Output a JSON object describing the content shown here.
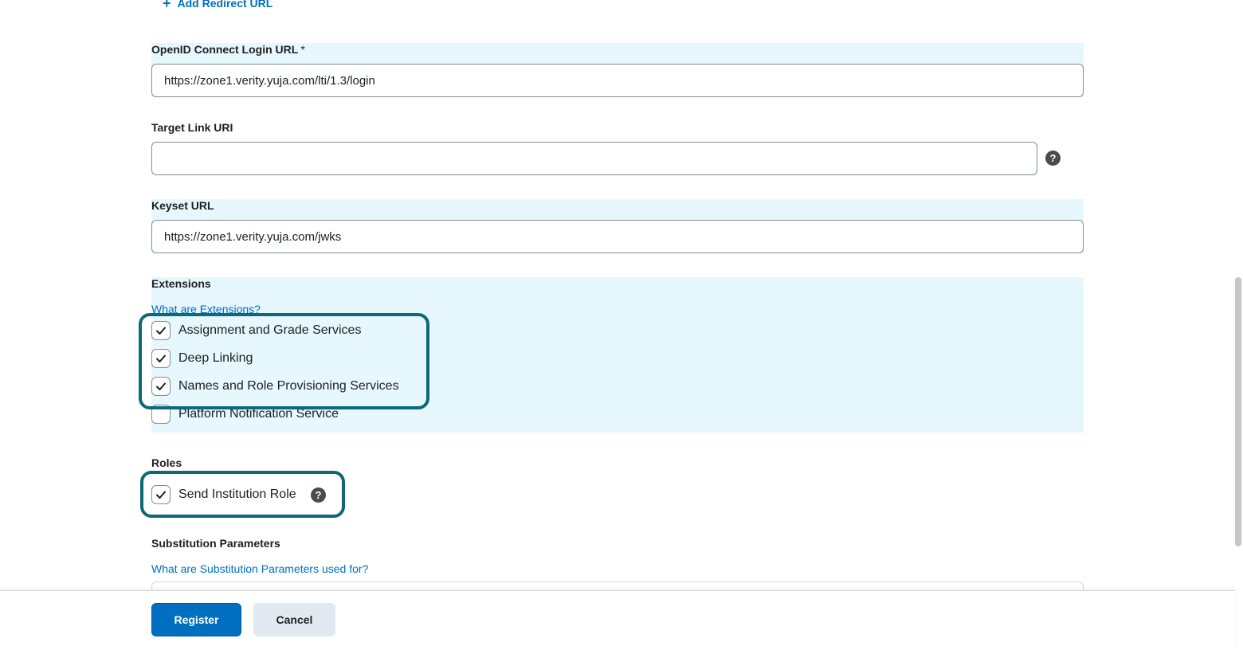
{
  "add_redirect": {
    "icon": "plus-icon",
    "label": "Add Redirect URL"
  },
  "openid": {
    "label": "OpenID Connect Login URL",
    "required_marker": "*",
    "value": "https://zone1.verity.yuja.com/lti/1.3/login"
  },
  "target_link": {
    "label": "Target Link URI",
    "value": "",
    "help_icon": "question-circle-icon"
  },
  "keyset": {
    "label": "Keyset URL",
    "value": "https://zone1.verity.yuja.com/jwks"
  },
  "extensions": {
    "label": "Extensions",
    "help_link": "What are Extensions?",
    "items": [
      {
        "label": "Assignment and Grade Services",
        "checked": true
      },
      {
        "label": "Deep Linking",
        "checked": true
      },
      {
        "label": "Names and Role Provisioning Services",
        "checked": true
      },
      {
        "label": "Platform Notification Service",
        "checked": false
      }
    ]
  },
  "roles": {
    "label": "Roles",
    "items": [
      {
        "label": "Send Institution Role",
        "checked": true
      }
    ],
    "help_icon": "question-circle-icon"
  },
  "substitution": {
    "label": "Substitution Parameters",
    "help_link": "What are Substitution Parameters used for?"
  },
  "footer": {
    "register": "Register",
    "cancel": "Cancel"
  },
  "colors": {
    "accent": "#006fbf",
    "highlight_bg": "#e6f7fe",
    "callout_border": "#0f6876",
    "secondary_button_bg": "#e3e9f1"
  }
}
